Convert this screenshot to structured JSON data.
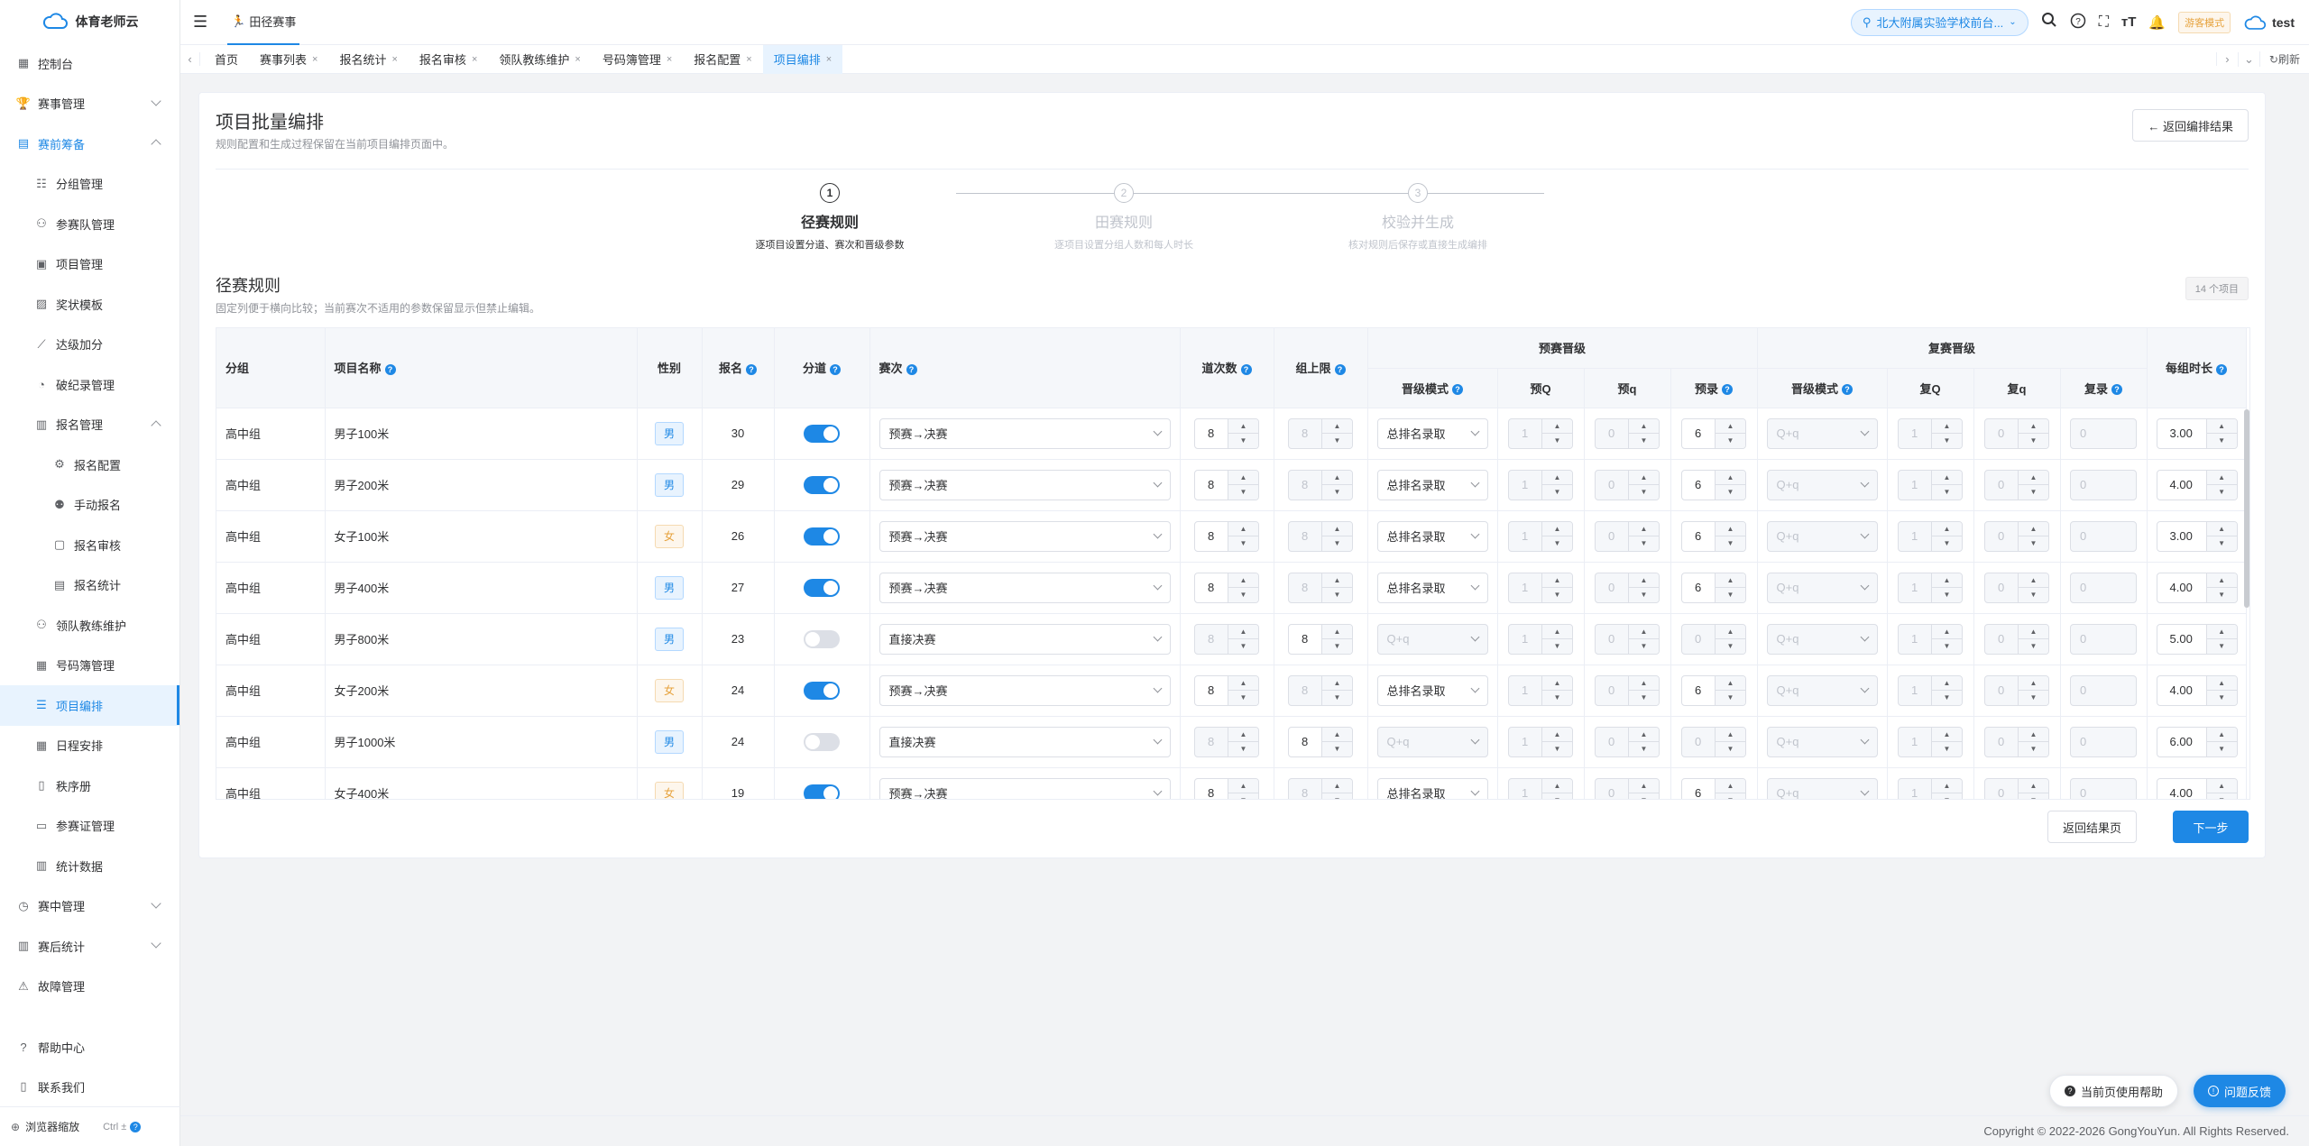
{
  "app": {
    "logo_text": "体育老师云"
  },
  "sidebar": {
    "items": [
      {
        "label": "控制台",
        "icon": "dashboard-icon"
      },
      {
        "label": "赛事管理",
        "icon": "trophy-icon"
      },
      {
        "label": "赛前筹备",
        "icon": "doc-icon"
      },
      {
        "label": "分组管理",
        "icon": "group-icon"
      },
      {
        "label": "参赛队管理",
        "icon": "team-icon"
      },
      {
        "label": "项目管理",
        "icon": "clipboard-icon"
      },
      {
        "label": "奖状模板",
        "icon": "certificate-icon"
      },
      {
        "label": "达级加分",
        "icon": "chart-icon"
      },
      {
        "label": "破纪录管理",
        "icon": "record-icon"
      },
      {
        "label": "报名管理",
        "icon": "signup-icon"
      },
      {
        "label": "报名配置",
        "icon": "config-icon"
      },
      {
        "label": "手动报名",
        "icon": "user-add-icon"
      },
      {
        "label": "报名审核",
        "icon": "audit-icon"
      },
      {
        "label": "报名统计",
        "icon": "stats-icon"
      },
      {
        "label": "领队教练维护",
        "icon": "coach-icon"
      },
      {
        "label": "号码簿管理",
        "icon": "bib-icon"
      },
      {
        "label": "项目编排",
        "icon": "schedule-list-icon"
      },
      {
        "label": "日程安排",
        "icon": "calendar-icon"
      },
      {
        "label": "秩序册",
        "icon": "book-icon"
      },
      {
        "label": "参赛证管理",
        "icon": "card-icon"
      },
      {
        "label": "统计数据",
        "icon": "bar-chart-icon"
      },
      {
        "label": "赛中管理",
        "icon": "stopwatch-icon"
      },
      {
        "label": "赛后统计",
        "icon": "summary-icon"
      },
      {
        "label": "故障管理",
        "icon": "fault-icon"
      }
    ],
    "help": "帮助中心",
    "contact": "联系我们",
    "zoom_label": "浏览器缩放",
    "zoom_hint": "Ctrl ±"
  },
  "topbar": {
    "breadcrumb": "田径赛事",
    "school": "北大附属实验学校前台...",
    "tourist_mode": "游客模式",
    "user": "test"
  },
  "tabs": [
    {
      "label": "首页",
      "closable": false
    },
    {
      "label": "赛事列表",
      "closable": true
    },
    {
      "label": "报名统计",
      "closable": true
    },
    {
      "label": "报名审核",
      "closable": true
    },
    {
      "label": "领队教练维护",
      "closable": true
    },
    {
      "label": "号码簿管理",
      "closable": true
    },
    {
      "label": "报名配置",
      "closable": true
    },
    {
      "label": "项目编排",
      "closable": true,
      "active": true
    }
  ],
  "tabs_refresh": "刷新",
  "page": {
    "title": "项目批量编排",
    "subtitle": "规则配置和生成过程保留在当前项目编排页面中。",
    "back_button": "← 返回编排结果",
    "steps": [
      {
        "num": "1",
        "title": "径赛规则",
        "desc": "逐项目设置分道、赛次和晋级参数"
      },
      {
        "num": "2",
        "title": "田赛规则",
        "desc": "逐项目设置分组人数和每人时长"
      },
      {
        "num": "3",
        "title": "校验并生成",
        "desc": "核对规则后保存或直接生成编排"
      }
    ],
    "section_title": "径赛规则",
    "section_desc": "固定列便于横向比较；当前赛次不适用的参数保留显示但禁止编辑。",
    "count_badge": "14 个项目",
    "btn_back_result": "返回结果页",
    "btn_next": "下一步"
  },
  "table": {
    "headers": {
      "group": "分组",
      "event": "项目名称",
      "gender": "性别",
      "signup": "报名",
      "lane": "分道",
      "round": "赛次",
      "lanes": "道次数",
      "cap": "组上限",
      "prelim": "预赛晋级",
      "semi": "复赛晋级",
      "duration": "每组时长",
      "p_mode": "晋级模式",
      "p_Q": "预Q",
      "p_q": "预q",
      "p_rec": "预录",
      "s_mode": "晋级模式",
      "s_Q": "复Q",
      "s_q": "复q",
      "s_rec": "复录"
    },
    "rows": [
      {
        "group": "高中组",
        "event": "男子100米",
        "gender": "男",
        "g": "m",
        "signup": "30",
        "lane": true,
        "round": "预赛→决赛",
        "lanes": "8",
        "cap": "8",
        "pmode": "总排名录取",
        "pQ": "1",
        "pq": "0",
        "prec": "6",
        "smode": "Q+q",
        "sQ": "1",
        "sq": "0",
        "srec": "0",
        "dur": "3.00"
      },
      {
        "group": "高中组",
        "event": "男子200米",
        "gender": "男",
        "g": "m",
        "signup": "29",
        "lane": true,
        "round": "预赛→决赛",
        "lanes": "8",
        "cap": "8",
        "pmode": "总排名录取",
        "pQ": "1",
        "pq": "0",
        "prec": "6",
        "smode": "Q+q",
        "sQ": "1",
        "sq": "0",
        "srec": "0",
        "dur": "4.00"
      },
      {
        "group": "高中组",
        "event": "女子100米",
        "gender": "女",
        "g": "f",
        "signup": "26",
        "lane": true,
        "round": "预赛→决赛",
        "lanes": "8",
        "cap": "8",
        "pmode": "总排名录取",
        "pQ": "1",
        "pq": "0",
        "prec": "6",
        "smode": "Q+q",
        "sQ": "1",
        "sq": "0",
        "srec": "0",
        "dur": "3.00"
      },
      {
        "group": "高中组",
        "event": "男子400米",
        "gender": "男",
        "g": "m",
        "signup": "27",
        "lane": true,
        "round": "预赛→决赛",
        "lanes": "8",
        "cap": "8",
        "pmode": "总排名录取",
        "pQ": "1",
        "pq": "0",
        "prec": "6",
        "smode": "Q+q",
        "sQ": "1",
        "sq": "0",
        "srec": "0",
        "dur": "4.00"
      },
      {
        "group": "高中组",
        "event": "男子800米",
        "gender": "男",
        "g": "m",
        "signup": "23",
        "lane": false,
        "round": "直接决赛",
        "lanes": "8",
        "cap": "8",
        "pmode": "Q+q",
        "pQ": "1",
        "pq": "0",
        "prec": "0",
        "smode": "Q+q",
        "sQ": "1",
        "sq": "0",
        "srec": "0",
        "dur": "5.00"
      },
      {
        "group": "高中组",
        "event": "女子200米",
        "gender": "女",
        "g": "f",
        "signup": "24",
        "lane": true,
        "round": "预赛→决赛",
        "lanes": "8",
        "cap": "8",
        "pmode": "总排名录取",
        "pQ": "1",
        "pq": "0",
        "prec": "6",
        "smode": "Q+q",
        "sQ": "1",
        "sq": "0",
        "srec": "0",
        "dur": "4.00"
      },
      {
        "group": "高中组",
        "event": "男子1000米",
        "gender": "男",
        "g": "m",
        "signup": "24",
        "lane": false,
        "round": "直接决赛",
        "lanes": "8",
        "cap": "8",
        "pmode": "Q+q",
        "pQ": "1",
        "pq": "0",
        "prec": "0",
        "smode": "Q+q",
        "sQ": "1",
        "sq": "0",
        "srec": "0",
        "dur": "6.00"
      },
      {
        "group": "高中组",
        "event": "女子400米",
        "gender": "女",
        "g": "f",
        "signup": "19",
        "lane": true,
        "round": "预赛→决赛",
        "lanes": "8",
        "cap": "8",
        "pmode": "总排名录取",
        "pQ": "1",
        "pq": "0",
        "prec": "6",
        "smode": "Q+q",
        "sQ": "1",
        "sq": "0",
        "srec": "0",
        "dur": "4.00"
      }
    ]
  },
  "float": {
    "help_page": "当前页使用帮助",
    "feedback": "问题反馈"
  },
  "footer": {
    "copyright": "Copyright © 2022-2026 GongYouYun. All Rights Reserved."
  }
}
